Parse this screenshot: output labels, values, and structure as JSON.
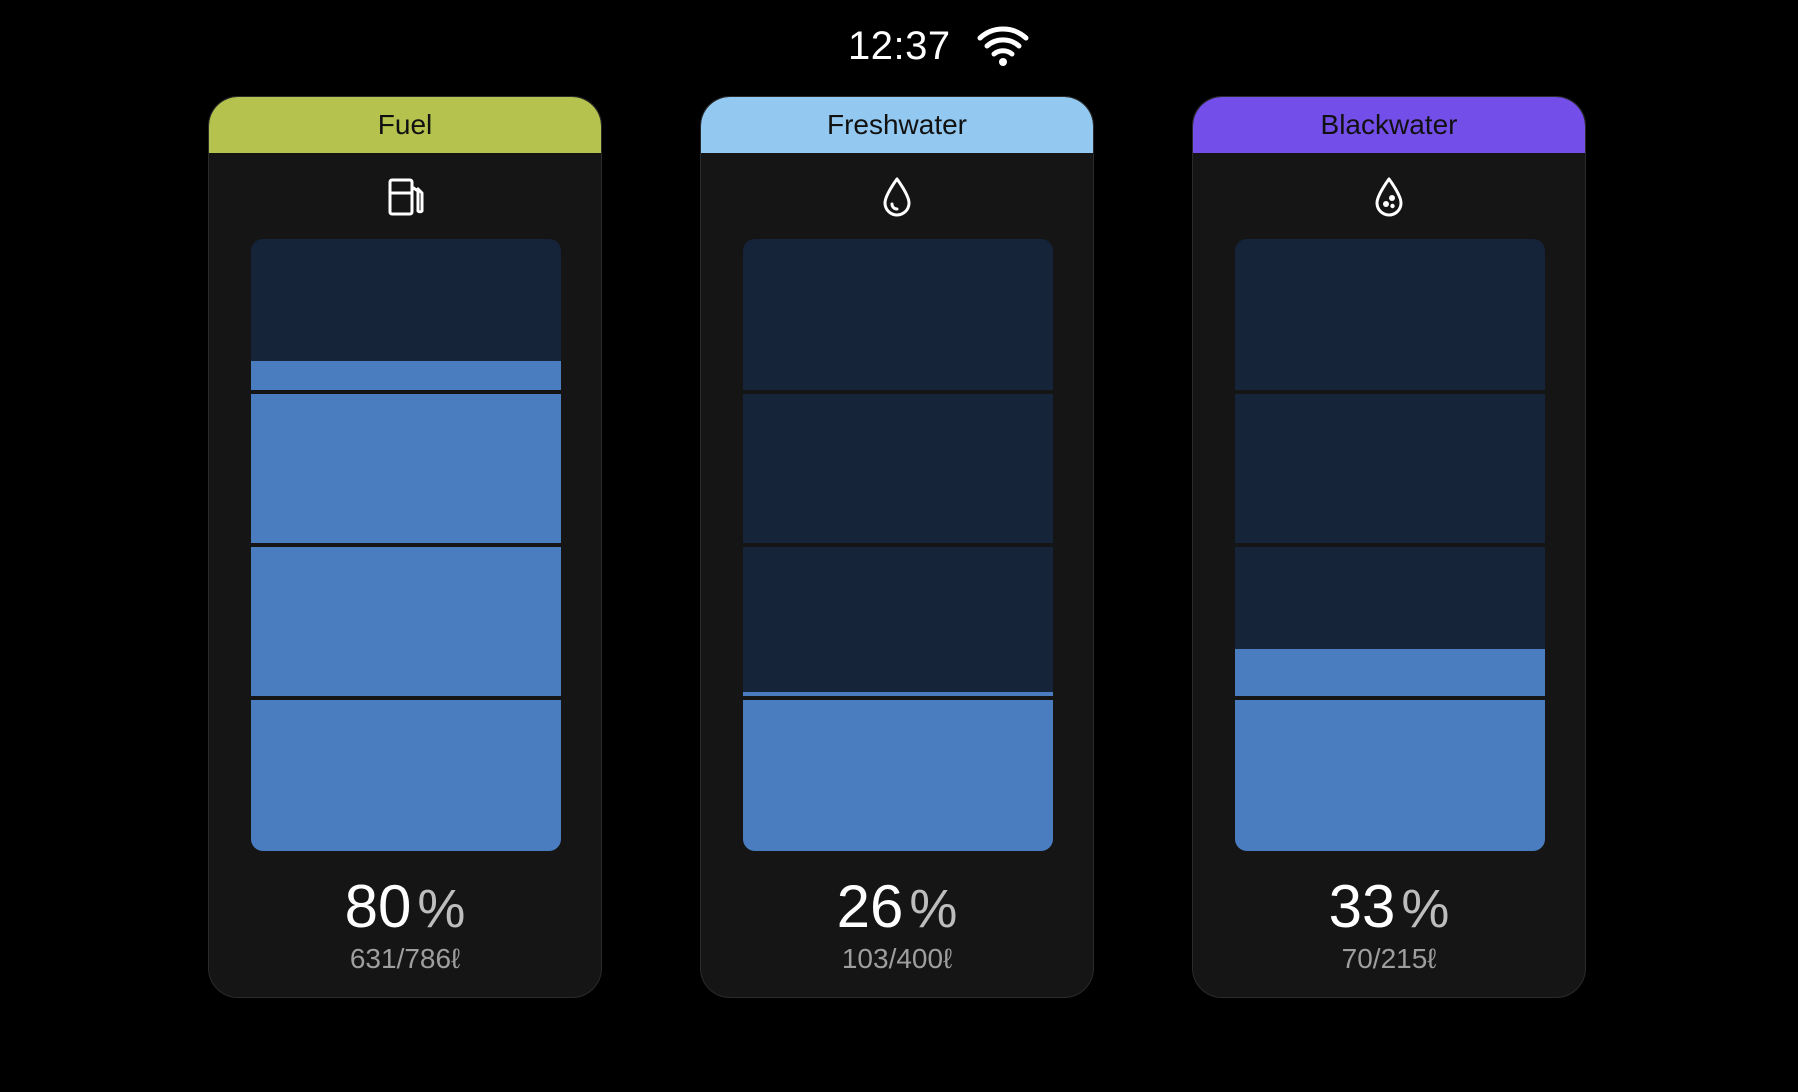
{
  "status_bar": {
    "time": "12:37",
    "wifi_icon": "wifi-icon"
  },
  "tanks": [
    {
      "name": "Fuel",
      "header_color": "#b5c24e",
      "icon": "fuel-pump-icon",
      "level_percent": 80,
      "percent_value": "80",
      "percent_sign": "%",
      "volume": "631/786ℓ"
    },
    {
      "name": "Freshwater",
      "header_color": "#93c9f0",
      "icon": "water-drop-icon",
      "level_percent": 26,
      "percent_value": "26",
      "percent_sign": "%",
      "volume": "103/400ℓ"
    },
    {
      "name": "Blackwater",
      "header_color": "#744ee8",
      "icon": "waste-drop-icon",
      "level_percent": 33,
      "percent_value": "33",
      "percent_sign": "%",
      "volume": "70/215ℓ"
    }
  ],
  "colors": {
    "tank_fill": "#4a7cc0",
    "tank_empty": "#16243a",
    "card_bg": "#151515"
  }
}
